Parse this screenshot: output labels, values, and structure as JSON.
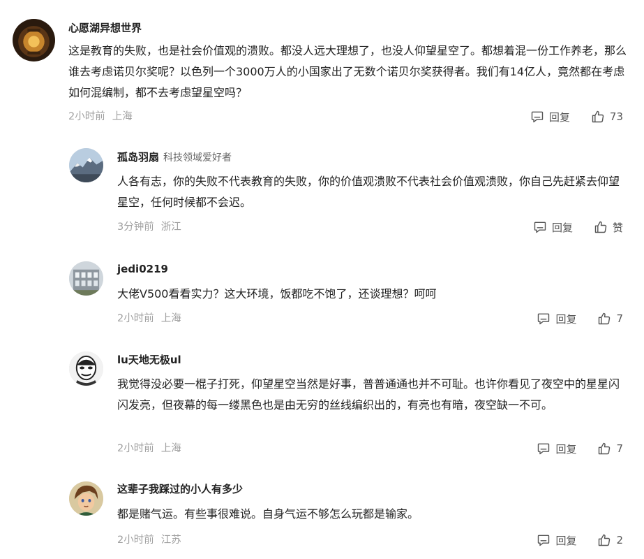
{
  "comments": [
    {
      "author": "心愿湖异想世界",
      "tagline": "",
      "content": "这是教育的失败，也是社会价值观的溃败。都没人远大理想了，也没人仰望星空了。都想着混一份工作养老，那么谁去考虑诺贝尔奖呢？以色列一个3000万人的小国家出了无数个诺贝尔奖获得者。我们有14亿人，竟然都在考虑如何混编制，都不去考虑望星空吗？",
      "time": "2小时前",
      "location": "上海",
      "reply_label": "回复",
      "like_label": "73",
      "avatar_icon": "lantern-photo"
    },
    {
      "author": "孤岛羽扇",
      "tagline": "科技领域爱好者",
      "content": "人各有志，你的失败不代表教育的失败，你的价值观溃败不代表社会价值观溃败，你自己先赶紧去仰望星空，任何时候都不会迟。",
      "time": "3分钟前",
      "location": "浙江",
      "reply_label": "回复",
      "like_label": "赞",
      "avatar_icon": "snow-mountain-photo"
    },
    {
      "author": "jedi0219",
      "tagline": "",
      "content": "大佬V500看看实力？这大环境，饭都吃不饱了，还谈理想？呵呵",
      "time": "2小时前",
      "location": "上海",
      "reply_label": "回复",
      "like_label": "7",
      "avatar_icon": "building-photo"
    },
    {
      "author": "lu天地无极ul",
      "tagline": "",
      "content": "我觉得没必要一棍子打死，仰望星空当然是好事，普普通通也并不可耻。也许你看见了夜空中的星星闪闪发亮，但夜幕的每一缕黑色也是由无穷的丝线编织出的，有亮也有暗，夜空缺一不可。",
      "time": "2小时前",
      "location": "上海",
      "reply_label": "回复",
      "like_label": "7",
      "avatar_icon": "mask-drawing"
    },
    {
      "author": "这辈子我踩过的小人有多少",
      "tagline": "",
      "content": "都是赌气运。有些事很难说。自身气运不够怎么玩都是输家。",
      "time": "2小时前",
      "location": "江苏",
      "reply_label": "回复",
      "like_label": "2",
      "avatar_icon": "anime-character"
    }
  ]
}
